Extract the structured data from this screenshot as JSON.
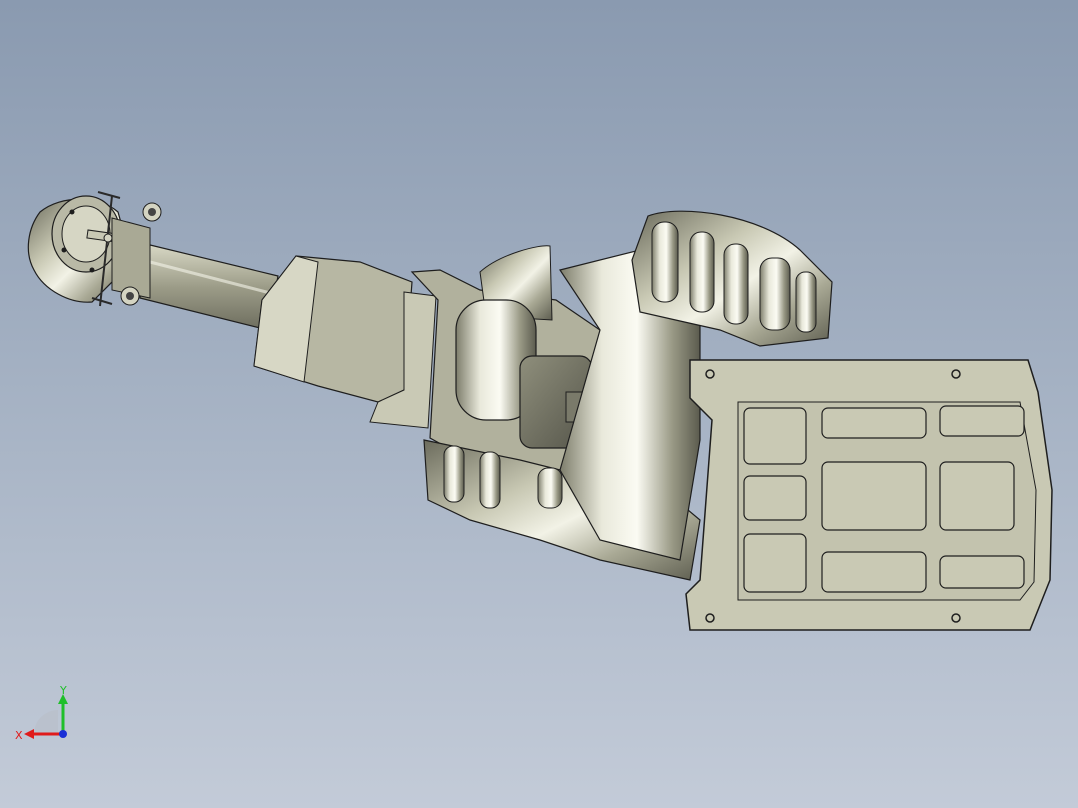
{
  "viewport": {
    "background_top": "#8a9ab0",
    "background_bottom": "#c3cbd8"
  },
  "model": {
    "part_color": "#c9c9b4",
    "edge_color": "#1e1e1e"
  },
  "triad": {
    "x_label": "X",
    "y_label": "Y",
    "x_color": "#e01b1b",
    "y_color": "#1fbf2a",
    "z_color": "#1a2fd6"
  }
}
